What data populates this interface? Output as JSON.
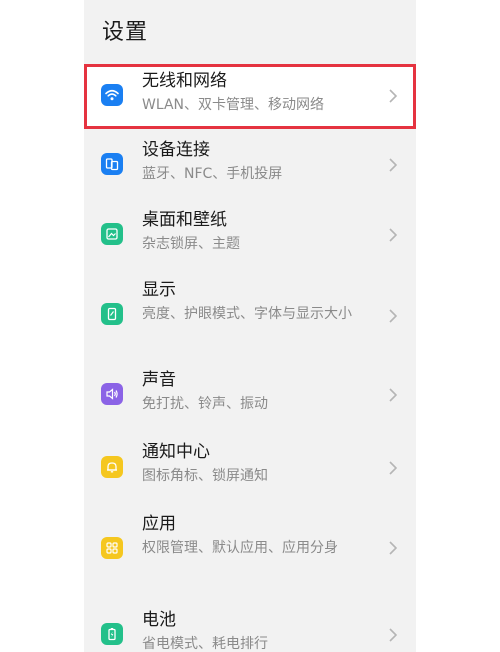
{
  "header": {
    "title": "设置"
  },
  "items": [
    {
      "title": "无线和网络",
      "subtitle": "WLAN、双卡管理、移动网络",
      "icon": "wifi-icon",
      "color": "#1a7ff2"
    },
    {
      "title": "设备连接",
      "subtitle": "蓝牙、NFC、手机投屏",
      "icon": "device-connection-icon",
      "color": "#1a7ff2"
    },
    {
      "title": "桌面和壁纸",
      "subtitle": "杂志锁屏、主题",
      "icon": "wallpaper-icon",
      "color": "#23c08a"
    },
    {
      "title": "显示",
      "subtitle": "亮度、护眼模式、字体与显示大小",
      "icon": "display-icon",
      "color": "#23c08a"
    },
    {
      "title": "声音",
      "subtitle": "免打扰、铃声、振动",
      "icon": "sound-icon",
      "color": "#8b63e6"
    },
    {
      "title": "通知中心",
      "subtitle": "图标角标、锁屏通知",
      "icon": "notification-bell-icon",
      "color": "#f5c71f"
    },
    {
      "title": "应用",
      "subtitle": "权限管理、默认应用、应用分身",
      "icon": "apps-icon",
      "color": "#f5c71f"
    },
    {
      "title": "电池",
      "subtitle": "省电模式、耗电排行",
      "icon": "battery-icon",
      "color": "#23c08a"
    }
  ],
  "colors": {
    "highlight": "#e53340",
    "background": "#f2f2f2"
  }
}
